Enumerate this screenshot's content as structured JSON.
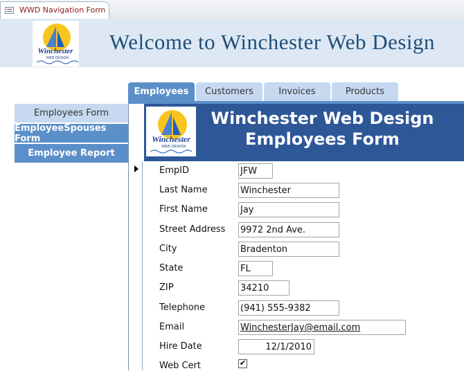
{
  "document_tab": {
    "label": "WWD Navigation Form",
    "icon": "form-icon"
  },
  "header": {
    "title": "Welcome to Winchester Web Design",
    "logo_text": "Winchester",
    "logo_subtext": "WEB DESIGN"
  },
  "nav_tabs": [
    {
      "label": "Employees",
      "active": true
    },
    {
      "label": "Customers",
      "active": false
    },
    {
      "label": "Invoices",
      "active": false
    },
    {
      "label": "Products",
      "active": false
    }
  ],
  "sidebar": {
    "items": [
      {
        "label": "Employees Form",
        "selected": true
      },
      {
        "label": "EmployeeSpouses Form",
        "selected": false
      },
      {
        "label": "Employee Report",
        "selected": false
      }
    ]
  },
  "form": {
    "title_line1": "Winchester Web Design",
    "title_line2": "Employees Form",
    "fields": {
      "empid": {
        "label": "EmpID",
        "value": "JFW"
      },
      "last_name": {
        "label": "Last Name",
        "value": "Winchester"
      },
      "first_name": {
        "label": "First Name",
        "value": "Jay"
      },
      "street": {
        "label": "Street Address",
        "value": "9972 2nd Ave."
      },
      "city": {
        "label": "City",
        "value": "Bradenton"
      },
      "state": {
        "label": "State",
        "value": "FL"
      },
      "zip": {
        "label": "ZIP",
        "value": "34210"
      },
      "telephone": {
        "label": "Telephone",
        "value": "(941) 555-9382"
      },
      "email": {
        "label": "Email",
        "value": "WinchesterJay@email.com"
      },
      "hire_date": {
        "label": "Hire Date",
        "value": "12/1/2010"
      },
      "web_cert": {
        "label": "Web Cert",
        "checked": true,
        "check_glyph": "✔"
      }
    }
  },
  "colors": {
    "accent": "#5b8fc9",
    "header_band": "#dde8f4",
    "title_blue": "#1f4e79",
    "form_header": "#2e5797",
    "tab_inactive": "#c6d9f1"
  }
}
